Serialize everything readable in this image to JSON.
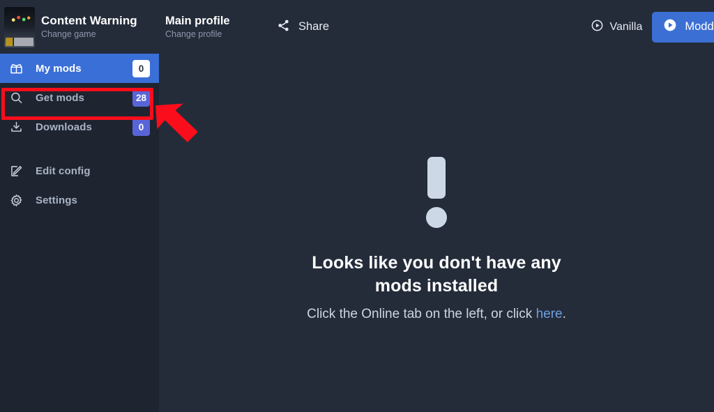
{
  "header": {
    "game": {
      "icon": "game-thumbnail",
      "title": "Content Warning",
      "subtitle": "Change game"
    },
    "profile": {
      "title": "Main profile",
      "subtitle": "Change profile"
    },
    "share": {
      "icon": "share-icon",
      "label": "Share"
    },
    "launch": {
      "vanilla": {
        "icon": "play-circle-outline-icon",
        "label": "Vanilla"
      },
      "modded": {
        "icon": "play-circle-filled-icon",
        "label": "Modded",
        "color": "#3b6fd4"
      }
    }
  },
  "sidebar": {
    "items": [
      {
        "icon": "open-box-icon",
        "label": "My mods",
        "badge": "0",
        "badge_style": "light",
        "active": true
      },
      {
        "icon": "search-icon",
        "label": "Get mods",
        "badge": "28",
        "badge_style": "blue",
        "active": false
      },
      {
        "icon": "download-icon",
        "label": "Downloads",
        "badge": "0",
        "badge_style": "blue",
        "active": false
      },
      {
        "icon": "edit-pencil-icon",
        "label": "Edit config",
        "badge": "",
        "badge_style": "none",
        "active": false
      },
      {
        "icon": "gear-icon",
        "label": "Settings",
        "badge": "",
        "badge_style": "none",
        "active": false
      }
    ]
  },
  "main": {
    "empty_state": {
      "icon": "exclamation-mark-icon",
      "title": "Looks like you don't have any mods installed",
      "subtitle_before": "Click the Online tab on the left, or click ",
      "link_label": "here",
      "subtitle_after": "."
    }
  },
  "annotations": {
    "highlight_color": "#fc0d1b",
    "highlight_target": "Get mods",
    "arrow_color": "#fc0d1b"
  }
}
